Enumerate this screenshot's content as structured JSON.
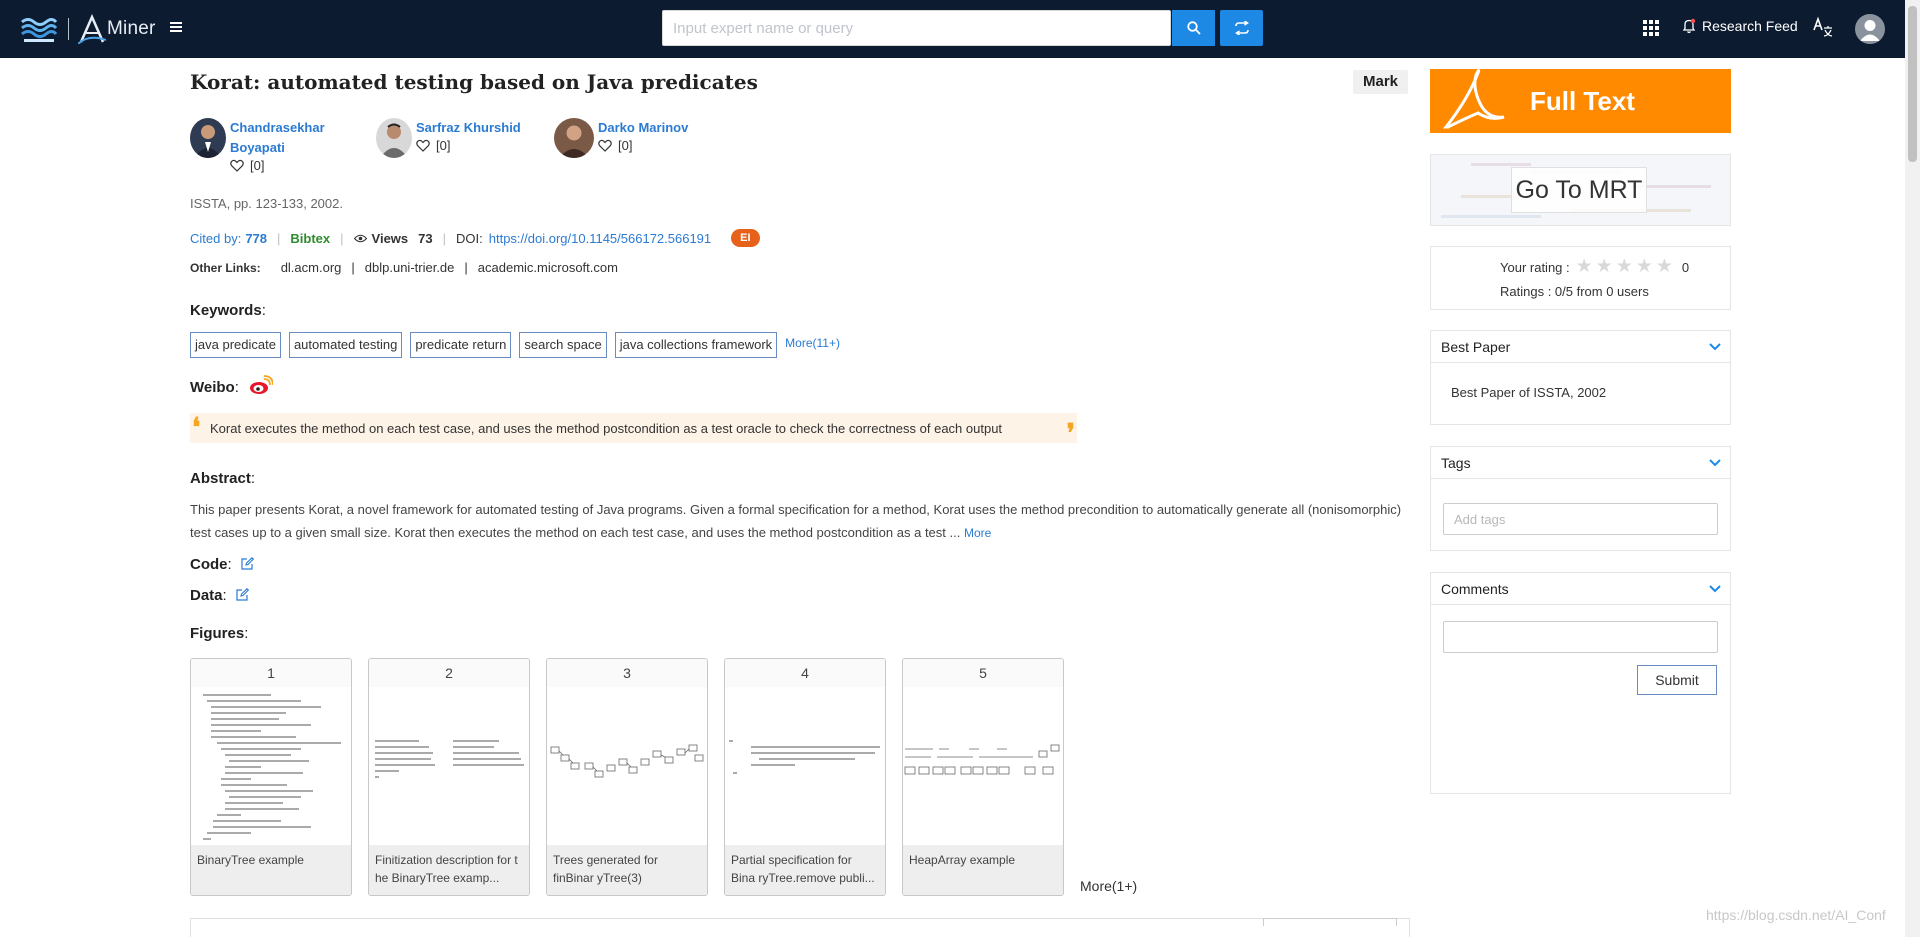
{
  "header": {
    "brand": "Miner",
    "search_placeholder": "Input expert name or query",
    "research_feed": "Research Feed",
    "icons": [
      "aceman-logo",
      "aminer-logo",
      "menu-icon",
      "search-icon",
      "switch-icon",
      "apps-grid-icon",
      "bell-icon",
      "translate-icon",
      "user-avatar-icon"
    ],
    "accent_color": "#1e88e5",
    "bar_color": "#0d1b30"
  },
  "paper": {
    "title": "Korat: automated testing based on Java predicates",
    "mark_label": "Mark",
    "authors": [
      {
        "name_line1": "Chandrasekhar",
        "name_line2": "Boyapati",
        "likes": "[0]"
      },
      {
        "name_line1": "Sarfraz Khurshid",
        "name_line2": "",
        "likes": "[0]"
      },
      {
        "name_line1": "Darko Marinov",
        "name_line2": "",
        "likes": "[0]"
      }
    ],
    "venue": "ISSTA, pp. 123-133, 2002.",
    "cited_label": "Cited by:",
    "cited_count": "778",
    "bibtex": "Bibtex",
    "views_label": "Views",
    "views_count": "73",
    "doi_label": "DOI:",
    "doi": "https://doi.org/10.1145/566172.566191",
    "badge": "EI",
    "other_links_label": "Other Links:",
    "other_links": [
      "dl.acm.org",
      "dblp.uni-trier.de",
      "academic.microsoft.com"
    ]
  },
  "keywords": {
    "label": "Keywords",
    "items": [
      "java predicate",
      "automated testing",
      "predicate return",
      "search space",
      "java collections framework"
    ],
    "more": "More(11+)"
  },
  "weibo": {
    "label": "Weibo",
    "quote": "Korat executes the method on each test case, and uses the method postcondition as a test oracle to check the correctness of each output"
  },
  "abstract": {
    "label": "Abstract",
    "text": "This paper presents Korat, a novel framework for automated testing of Java programs. Given a formal specification for a method, Korat uses the method precondition to automatically generate all (nonisomorphic) test cases up to a given small size. Korat then executes the method on each test case, and uses the method postcondition as a test ...",
    "more": "More"
  },
  "code_label": "Code",
  "data_label": "Data",
  "figures": {
    "label": "Figures",
    "items": [
      {
        "num": "1",
        "caption": "BinaryTree example"
      },
      {
        "num": "2",
        "caption": "Finitization description for t he BinaryTree examp..."
      },
      {
        "num": "3",
        "caption": "Trees generated for finBinar yTree(3)"
      },
      {
        "num": "4",
        "caption": "Partial specification for Bina ryTree.remove publi..."
      },
      {
        "num": "5",
        "caption": "HeapArray example"
      }
    ],
    "more": "More(1+)"
  },
  "sidebar": {
    "full_text": "Full Text",
    "go_to_mrt": "Go To MRT",
    "your_rating_label": "Your rating :",
    "your_rating_value": "0",
    "ratings_summary": "Ratings : 0/5 from 0 users",
    "best_paper": {
      "title": "Best Paper",
      "content": "Best Paper of ISSTA, 2002"
    },
    "tags": {
      "title": "Tags",
      "placeholder": "Add tags"
    },
    "comments": {
      "title": "Comments",
      "submit": "Submit"
    },
    "fulltext_color": "#ff8a00"
  },
  "watermark": "https://blog.csdn.net/AI_Conf"
}
